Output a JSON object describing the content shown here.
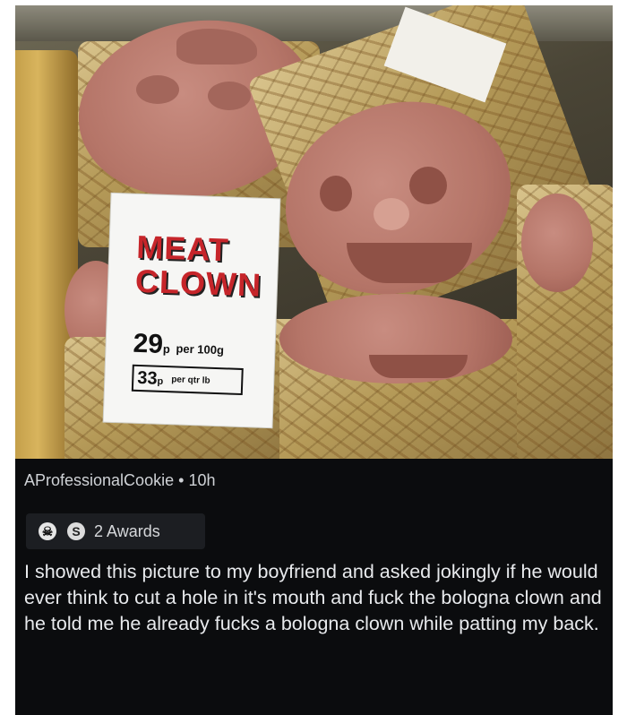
{
  "photo": {
    "sign_title": "MEAT\nCLOWN",
    "price_main": "29",
    "price_main_unit": "p",
    "price_main_per": "per 100g",
    "price_sub": "33",
    "price_sub_unit": "p",
    "price_sub_per": "per qtr lb"
  },
  "comment": {
    "username": "AProfessionalCookie",
    "separator": "•",
    "age": "10h",
    "awards_label": "2 Awards",
    "award_icons": [
      "skull-award-icon",
      "silver-award-icon"
    ],
    "body": "I showed this picture to my boyfriend and asked jokingly if he would ever think to cut a hole in it's mouth and fuck the bologna clown and he told me he already fucks a bologna clown while patting my back."
  }
}
